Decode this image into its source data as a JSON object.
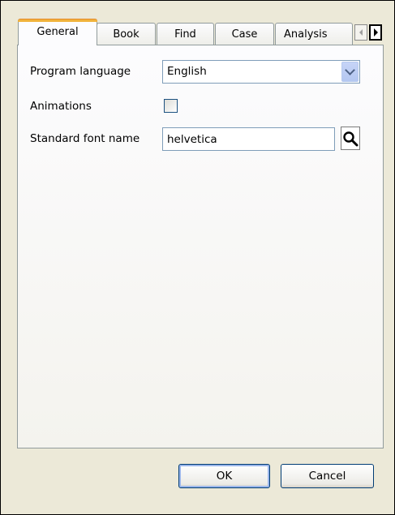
{
  "tabs": [
    {
      "label": "General",
      "active": true
    },
    {
      "label": "Book",
      "active": false
    },
    {
      "label": "Find",
      "active": false
    },
    {
      "label": "Case",
      "active": false
    },
    {
      "label": "Analysis",
      "active": false
    }
  ],
  "general": {
    "program_language_label": "Program language",
    "program_language_value": "English",
    "animations_label": "Animations",
    "animations_checked": false,
    "font_label": "Standard font name",
    "font_value": "helvetica"
  },
  "buttons": {
    "ok": "OK",
    "cancel": "Cancel"
  },
  "icons": {
    "tab_scroll_left": "triangle-left-icon",
    "tab_scroll_right": "triangle-right-icon",
    "dropdown": "chevron-down-icon",
    "search": "magnifier-icon"
  },
  "colors": {
    "active_tab_accent": "#f1b33c",
    "dialog_background": "#ece9d8",
    "input_border": "#7f9db9"
  }
}
